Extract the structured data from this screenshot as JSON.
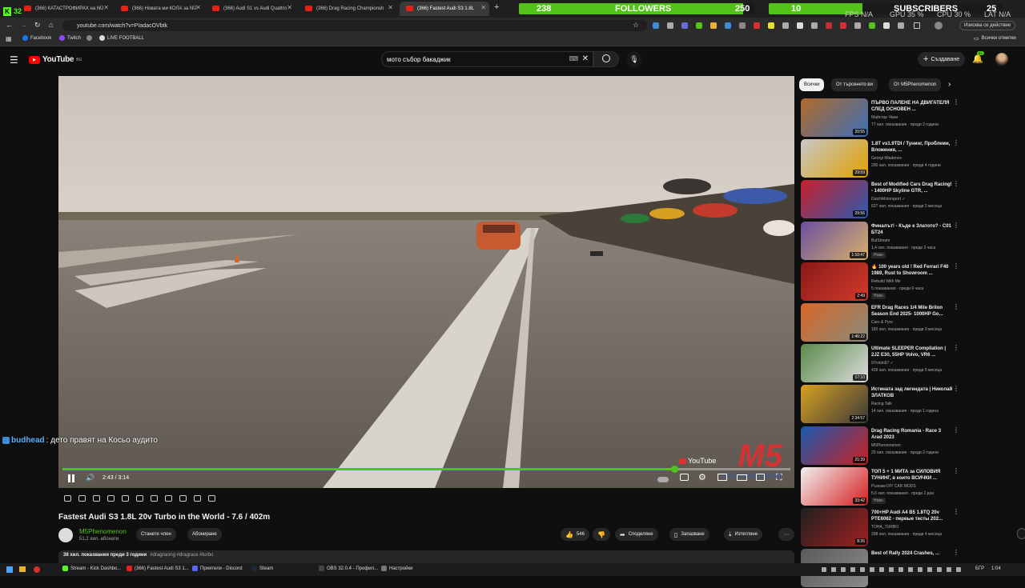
{
  "kick": {
    "count": "32"
  },
  "tabs": [
    {
      "title": "(366) КАТАСТРОФИРАХ на NÜ",
      "active": false
    },
    {
      "title": "(366) Новата ми КОЛА за NÜ",
      "active": false
    },
    {
      "title": "(366) Audi S1 vs Audi Quattro",
      "active": false
    },
    {
      "title": "(366) Drag Racing Championsh",
      "active": false
    },
    {
      "title": "(366) Fastest Audi S3 1.8L",
      "active": true
    }
  ],
  "overlay": {
    "followers_current": "238",
    "followers_label": "FOLLOWERS",
    "followers_goal": "250",
    "subs_current": "10",
    "subs_label": "SUBSCRIBERS",
    "subs_goal": "25",
    "fps": "FPS N/A",
    "gpu": "GPU 35 %",
    "cpu": "CPU 30 %",
    "lat": "LAT N/A"
  },
  "address": {
    "url": "youtube.com/watch?v=PIadacOVbtk",
    "right_label": "Изисква се действие"
  },
  "bookmarks": [
    {
      "label": "Facebook",
      "color": "#1877f2"
    },
    {
      "label": "Twitch",
      "color": "#9146ff"
    },
    {
      "label": "",
      "color": "#888"
    },
    {
      "label": "LIVE FOOTBALL",
      "color": "#ddd"
    }
  ],
  "bookmarks_right": "Всички отметки",
  "yt": {
    "logo": "YouTube",
    "region": "BG",
    "search_value": "мото събор бакаджик",
    "create_label": "Създаване",
    "notif_count": "9+"
  },
  "player": {
    "time": "2:43 / 3:14",
    "progress": 0.84,
    "watermark": "M5",
    "watermark_sub": "PHENOMENON",
    "yt_mark": "YouTube"
  },
  "chat": {
    "user": "budhead",
    "message": ": дето правят на Косьо аудито"
  },
  "video": {
    "title": "Fastest Audi S3 1.8L 20v Turbo in the World - 7.6 / 402m",
    "channel": "M5Phenomenon",
    "subs": "51,2 хил. абонати",
    "join": "Станете член",
    "subscribe": "Абониране",
    "likes": "546",
    "share": "Споделяне",
    "save": "Запазване",
    "download": "Изтегляне",
    "desc_meta": "38 хил. показвания  преди 3 години",
    "desc_tags": "#dragracing #dragrace #turbo"
  },
  "chips": [
    "Всички",
    "От търсенето ви",
    "От M5Phenomenon"
  ],
  "recs": [
    {
      "title": "ПЪРВО ПАЛЕНЕ НА ДВИГАТЕЛЯ СЛЕД ОСНОВЕН ...",
      "channel": "Майстор Чани",
      "meta": "77 хил. показвания · преди 2 години",
      "dur": "20:55",
      "badge": "",
      "c1": "#b06a2a",
      "c2": "#3d6fb8"
    },
    {
      "title": "1.8T vs1.9TDI / Тунинг, Проблеми, Вложения, ...",
      "channel": "Georgi Mladenov",
      "meta": "200 хил. показвания · преди 4 години",
      "dur": "29:59",
      "badge": "",
      "c1": "#c9c9c9",
      "c2": "#e0a100"
    },
    {
      "title": "Best of Modified Cars Drag Racing! - 1400HP Skyline GTR, ...",
      "channel": "DutchMotorsport ✓",
      "meta": "627 хил. показвания · преди 2 месеца",
      "dur": "29:56",
      "badge": "",
      "c1": "#c8202a",
      "c2": "#2c5bb0"
    },
    {
      "title": "Финалът! - Къде е Златото? - C01 БТ24",
      "channel": "BulStream",
      "meta": "1,4 хил. показвания · преди 3 часа",
      "dur": "1:10:47",
      "badge": "Ново",
      "c1": "#6a4fa0",
      "c2": "#d8b06a"
    },
    {
      "title": "🔥 100 years old ! Red Ferrari F40 1989, Rust to Showroom ...",
      "channel": "Rebuild With Me",
      "meta": "5 показвания · преди 6 часа",
      "dur": "2:49",
      "badge": "Ново",
      "c1": "#8a1a1a",
      "c2": "#d23a2a"
    },
    {
      "title": "EFR Drag Races 1/4 Mile Brilon Season End 2025- 1000HP Go...",
      "channel": "Cars & Pyro",
      "meta": "183 хил. показвания · преди 3 месеца",
      "dur": "1:46:22",
      "badge": "",
      "c1": "#d8662a",
      "c2": "#8a8a7a"
    },
    {
      "title": "Ultimate SLEEPER Compilation | 2JZ E30, 55HP Volvo, VR6 ...",
      "channel": "97robin97 ✓",
      "meta": "439 хил. показвания · преди 5 месеца",
      "dur": "17:10",
      "badge": "",
      "c1": "#5a8a4a",
      "c2": "#dcdcdc"
    },
    {
      "title": "Истината зад легендата | Николай ЗЛАТКОВ",
      "channel": "Racing Talk",
      "meta": "14 хил. показвания · преди 1 година",
      "dur": "2:34:57",
      "badge": "",
      "c1": "#d8a020",
      "c2": "#3a3a3a"
    },
    {
      "title": "Drag Racing Romania - Race 3 Arad 2023",
      "channel": "M5Phenomenon",
      "meta": "20 хил. показвания · преди 2 години",
      "dur": "21:39",
      "badge": "",
      "c1": "#1a5ab0",
      "c2": "#c82020"
    },
    {
      "title": "ТОП 5 + 1 МИТА за СИЛОВИЯ ТУНИНГ, в които ВСИЧКИ ...",
      "channel": "Рънкам DIY CAR MODS",
      "meta": "5,6 хил. показвания · преди 2 дни",
      "dur": "33:42",
      "badge": "Ново",
      "c1": "#f0f0f0",
      "c2": "#d82020"
    },
    {
      "title": "700+HP Audi A4 B5 1.8TQ 20v PTE6062 - первые тесты 202...",
      "channel": "TOHA_TURBO",
      "meta": "298 хил. показвания · преди 4 месеца",
      "dur": "8:26",
      "badge": "",
      "c1": "#202020",
      "c2": "#a02020"
    },
    {
      "title": "Best of Rally 2024 Crashes, ...",
      "channel": "",
      "meta": "",
      "dur": "",
      "badge": "",
      "c1": "#5a5a5a",
      "c2": "#8a8a8a"
    }
  ],
  "taskbar": {
    "apps": [
      {
        "label": "Stream - Kick Dashbo...",
        "color": "#53fc18"
      },
      {
        "label": "(366) Fastest Audi S3 1...",
        "color": "#e62117"
      },
      {
        "label": "Приятели - Discord",
        "color": "#5865f2"
      },
      {
        "label": "Steam",
        "color": "#1b2838"
      },
      {
        "label": "OBS 32.0.4 - Профил...",
        "color": "#444"
      },
      {
        "label": "Настройки",
        "color": "#777"
      }
    ],
    "lang": "БГР",
    "clock": "1:04"
  }
}
